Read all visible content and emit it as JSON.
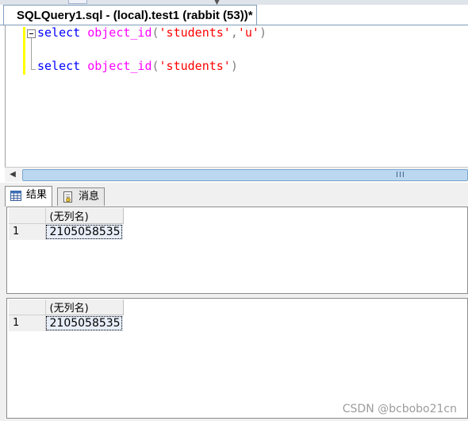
{
  "window": {
    "doc_tab_title": "SQLQuery1.sql - (local).test1 (rabbit (53))*"
  },
  "editor": {
    "lines": [
      {
        "keyword": "select",
        "function": "object_id",
        "open": "(",
        "arg1": "'students'",
        "comma": ",",
        "arg2": "'u'",
        "close": ")"
      },
      {
        "keyword": "select",
        "function": "object_id",
        "open": "(",
        "arg1": "'students'",
        "close": ")"
      }
    ]
  },
  "scrollbar": {
    "left_arrow": "◀",
    "grip": "III"
  },
  "result_tabs": [
    {
      "label": "结果",
      "icon": "grid-icon",
      "active": true
    },
    {
      "label": "消息",
      "icon": "message-icon",
      "active": false
    }
  ],
  "result_sets": [
    {
      "column_header": "(无列名)",
      "rows": [
        {
          "row_number": "1",
          "value": "2105058535"
        }
      ]
    },
    {
      "column_header": "(无列名)",
      "rows": [
        {
          "row_number": "1",
          "value": "2105058535"
        }
      ]
    }
  ],
  "watermark": "CSDN @bcbobo21cn"
}
